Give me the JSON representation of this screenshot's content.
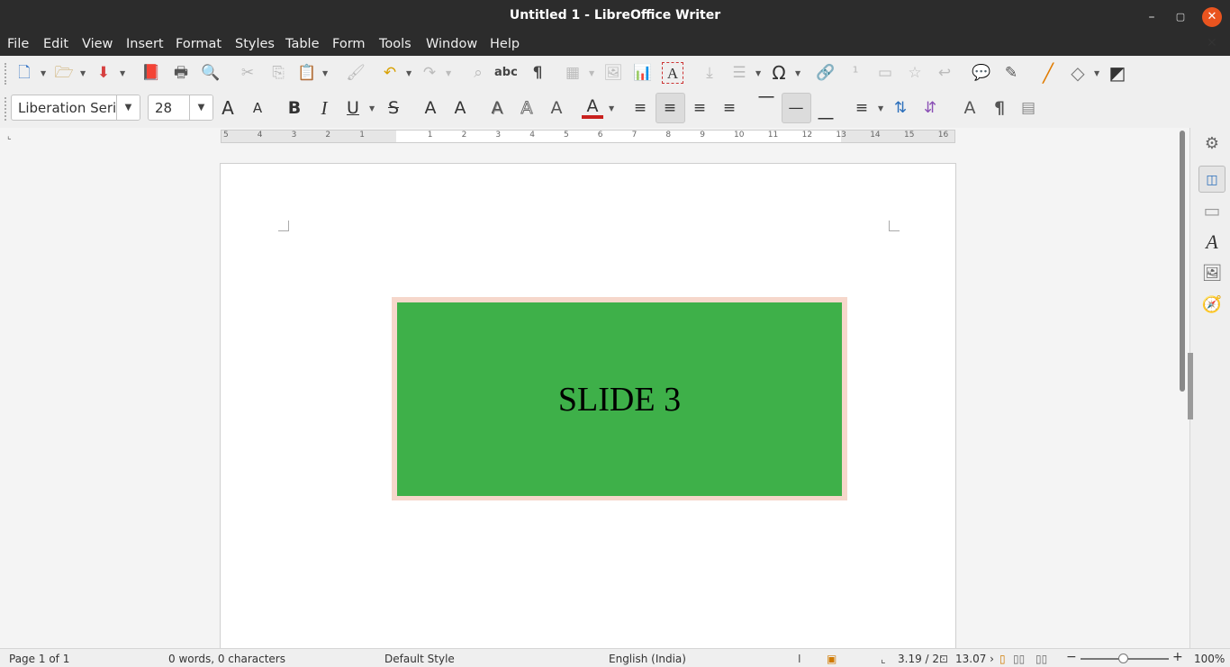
{
  "window": {
    "title": "Untitled 1 - LibreOffice Writer",
    "minimize_glyph": "–",
    "maximize_glyph": "▢",
    "close_glyph": "✕",
    "doc_close_glyph": "✕"
  },
  "menu": {
    "file": "File",
    "edit": "Edit",
    "view": "View",
    "insert": "Insert",
    "format": "Format",
    "styles": "Styles",
    "table": "Table",
    "form": "Form",
    "tools": "Tools",
    "window": "Window",
    "help": "Help"
  },
  "standard_toolbar": {
    "new": "🗋",
    "open": "🗁",
    "save": "⬇",
    "export_pdf": "📕",
    "print": "🖶",
    "print_preview": "🔍",
    "cut": "✂",
    "copy": "⎘",
    "paste": "📋",
    "clone": "🖌",
    "undo": "↶",
    "redo": "↷",
    "find_replace": "⌕",
    "spelling": "abc",
    "formatting_marks": "¶",
    "insert_table": "▦",
    "insert_image": "🖼",
    "insert_chart": "📊",
    "insert_textbox": "A",
    "page_break": "⤓",
    "insert_field": "☰",
    "special_character": "Ω",
    "hyperlink": "🔗",
    "footnote": "¹",
    "endnote": "▭",
    "bookmark": "☆",
    "cross_reference": "↩",
    "comment": "💬",
    "track_changes": "✎",
    "line": "╱",
    "basic_shapes": "◇",
    "draw_functions": "◩"
  },
  "formatting_toolbar": {
    "font_name": "Liberation Serif",
    "font_size": "28",
    "dropdown_arrow": "▼",
    "grow": "A",
    "shrink": "A",
    "bold": "B",
    "italic": "I",
    "underline": "U",
    "strikethrough": "S",
    "superscript": "A",
    "subscript": "A",
    "shadow": "A",
    "outline": "A",
    "clear": "A",
    "font_color": "A",
    "align_left": "≡",
    "align_center": "≡",
    "align_right": "≡",
    "justify": "≡",
    "align_top": "⎺",
    "align_middle": "—",
    "align_bottom": "⎽",
    "line_spacing": "≡",
    "increase_paragraph_spacing": "⇅",
    "decrease_paragraph_spacing": "⇵",
    "character": "A",
    "paragraph": "¶",
    "page": "▤"
  },
  "ruler": {
    "numbers": [
      "5",
      "4",
      "3",
      "2",
      "1",
      "1",
      "2",
      "3",
      "4",
      "5",
      "6",
      "7",
      "8",
      "9",
      "10",
      "11",
      "12",
      "13",
      "14",
      "15",
      "16"
    ]
  },
  "document": {
    "slide_text": "SLIDE 3",
    "slide_color": "#3eb049",
    "slide_border_color": "#f6d7cb"
  },
  "sidebar": {
    "properties": "⚙",
    "page": "▭",
    "styles": "A",
    "gallery": "🖼",
    "navigator": "🧭",
    "toggle": "◫"
  },
  "status": {
    "page": "Page 1 of 1",
    "words": "0 words, 0 characters",
    "style": "Default Style",
    "language": "English (India)",
    "position": "3.19 / 2:",
    "size": "13.07 ›",
    "zoom": "100%",
    "zoom_minus": "−",
    "zoom_plus": "+"
  }
}
